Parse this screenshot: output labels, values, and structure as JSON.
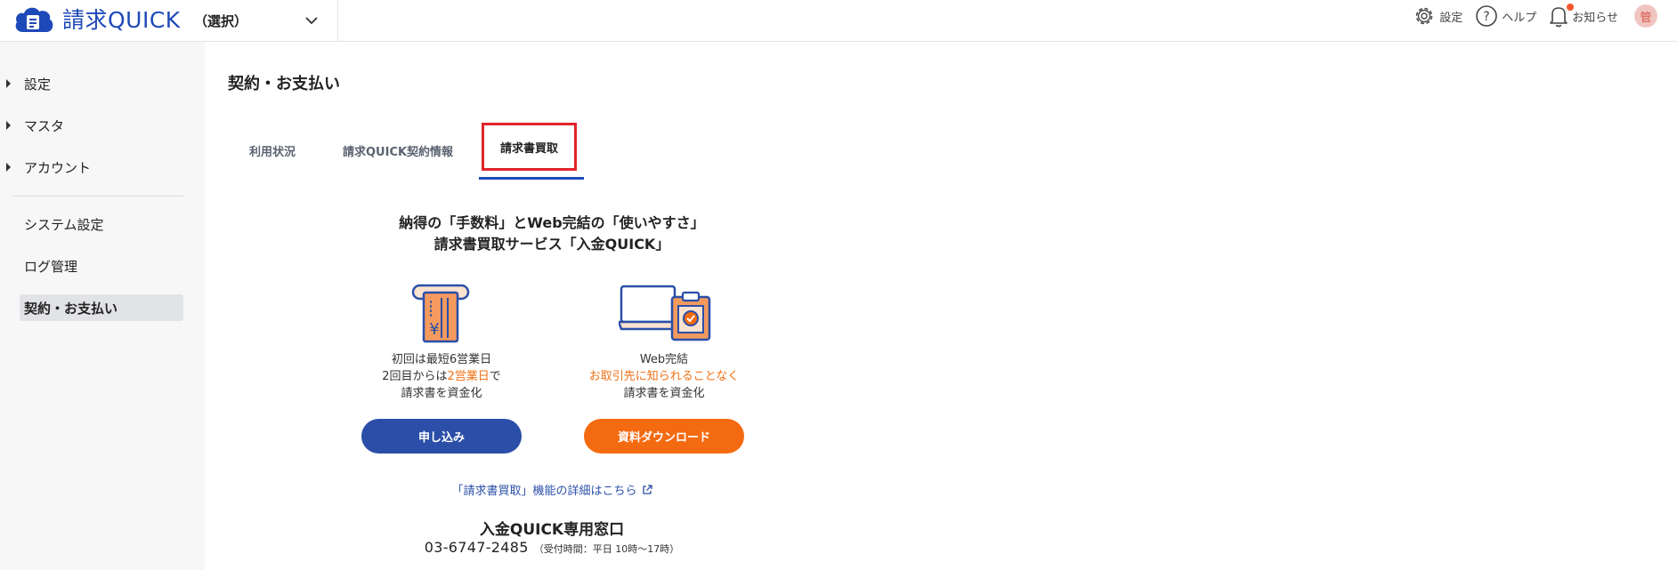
{
  "app": {
    "name": "請求QUICK"
  },
  "header": {
    "selector": "（選択）",
    "settings": "設定",
    "help": "ヘルプ",
    "notifications": "お知らせ",
    "avatar": "管"
  },
  "sidebar": {
    "groups": [
      "設定",
      "マスタ",
      "アカウント"
    ],
    "items": [
      "システム設定",
      "ログ管理"
    ],
    "active": "契約・お支払い"
  },
  "page": {
    "title": "契約・お支払い"
  },
  "tabs": {
    "usage": "利用状況",
    "contract": "請求QUICK契約情報",
    "purchase": "請求書買取"
  },
  "promo": {
    "line1": "納得の「手数料」とWeb完結の「使いやすさ」",
    "line2": "請求書買取サービス「入金QUICK」"
  },
  "features": {
    "left": {
      "line1": "初回は最短6営業日",
      "line2_pre": "2回目からは",
      "line2_highlight": "2営業日",
      "line2_post": "で",
      "line3": "請求書を資金化"
    },
    "right": {
      "line1": "Web完結",
      "line2_highlight": "お取引先に知られることなく",
      "line3": "請求書を資金化"
    }
  },
  "buttons": {
    "apply": "申し込み",
    "download": "資料ダウンロード"
  },
  "link": {
    "details": "「請求書買取」機能の詳細はこちら"
  },
  "contact": {
    "title": "入金QUICK専用窓口",
    "phone": "03-6747-2485",
    "hours": "（受付時間：平日 10時～17時）"
  },
  "colors": {
    "brand_blue": "#1e49b8",
    "accent_orange": "#f46a10",
    "highlight_red": "#e0232b"
  }
}
